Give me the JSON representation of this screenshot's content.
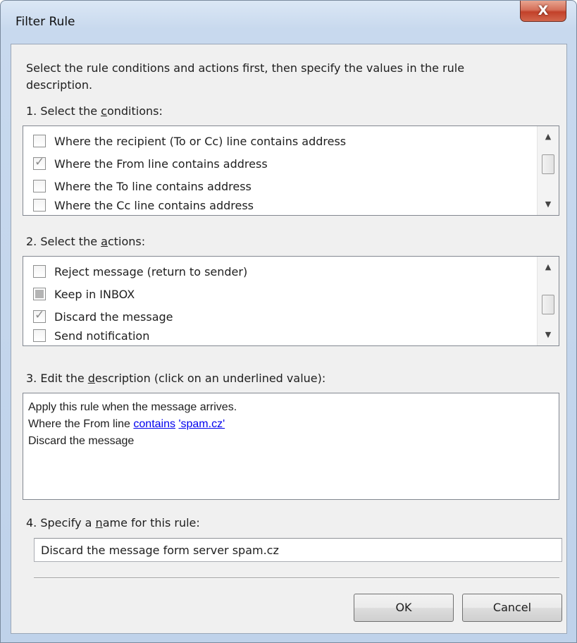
{
  "window": {
    "title": "Filter Rule",
    "close_glyph": "X"
  },
  "intro_text": "Select the rule conditions and actions first, then specify the values in the rule description.",
  "conditions": {
    "label_prefix": "1. Select the ",
    "label_key": "c",
    "label_suffix": "onditions:",
    "items": [
      {
        "label": "Where the recipient (To or Cc) line contains address",
        "state": "unchecked"
      },
      {
        "label": "Where the From line contains address",
        "state": "checked"
      },
      {
        "label": "Where the To line contains address",
        "state": "unchecked"
      },
      {
        "label": "Where the Cc line contains address",
        "state": "unchecked"
      }
    ]
  },
  "actions": {
    "label_prefix": "2. Select the ",
    "label_key": "a",
    "label_suffix": "ctions:",
    "items": [
      {
        "label": "Reject message (return to sender)",
        "state": "unchecked"
      },
      {
        "label": "Keep in INBOX",
        "state": "indeterminate"
      },
      {
        "label": "Discard the message",
        "state": "checked"
      },
      {
        "label": "Send notification",
        "state": "unchecked"
      }
    ]
  },
  "scrollbar": {
    "up_glyph": "▲",
    "down_glyph": "▼"
  },
  "description": {
    "label_prefix": "3. Edit the ",
    "label_key": "d",
    "label_suffix": "escription (click on an underlined value):",
    "line1": "Apply this rule when the message arrives.",
    "line2_prefix": "Where the From line ",
    "line2_link1": "contains",
    "line2_link2": "'spam.cz'",
    "line3": "Discard the message"
  },
  "rule_name": {
    "label_prefix": "4. Specify a ",
    "label_key": "n",
    "label_suffix": "ame for this rule:",
    "value": "Discard the message form server spam.cz"
  },
  "buttons": {
    "ok": "OK",
    "cancel": "Cancel"
  }
}
